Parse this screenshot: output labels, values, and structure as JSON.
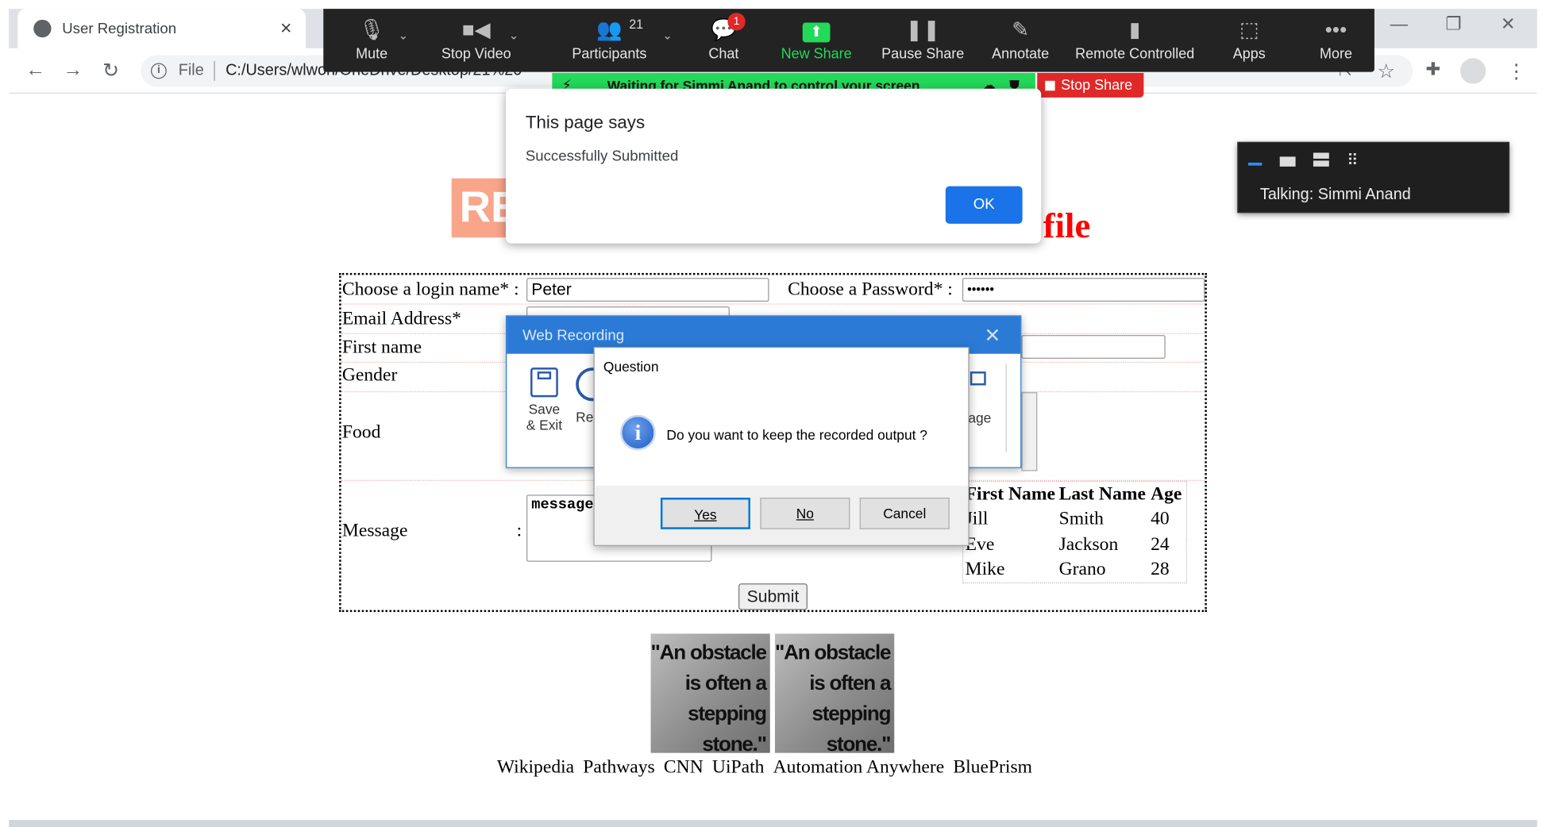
{
  "browser": {
    "tab_title": "User Registration",
    "tab_close": "×",
    "url_scheme": "File",
    "url_path": "C:/Users/wlwon/OneDrive/Desktop/21%20",
    "window_controls": [
      "—",
      "❐",
      "✕"
    ]
  },
  "zoom": {
    "buttons": [
      {
        "label": "Mute",
        "icon": "microphone-icon"
      },
      {
        "label": "Stop Video",
        "icon": "video-camera-icon"
      },
      {
        "label": "Participants",
        "icon": "participants-icon",
        "count": "21"
      },
      {
        "label": "Chat",
        "icon": "chat-icon",
        "badge": "1"
      },
      {
        "label": "New Share",
        "icon": "share-arrow-icon"
      },
      {
        "label": "Pause Share",
        "icon": "pause-icon"
      },
      {
        "label": "Annotate",
        "icon": "pencil-icon"
      },
      {
        "label": "Remote Controlled",
        "icon": "mouse-icon"
      },
      {
        "label": "Apps",
        "icon": "apps-icon"
      },
      {
        "label": "More",
        "icon": "ellipsis-icon"
      }
    ],
    "waiting_text": "Waiting for Simmi Anand to control your screen",
    "stop_share": "Stop Share",
    "talking": "Talking: Simmi Anand",
    "accent": "#23d959",
    "stop_color": "#e02828"
  },
  "page": {
    "logo_text": "REG",
    "title_tail": "file",
    "form": {
      "login_label": "Choose a login name* :",
      "login_value": "Peter",
      "password_label": "Choose a Password* :",
      "password_value": "••••••",
      "email_label": "Email Address*",
      "firstname_label": "First name",
      "gender_label": "Gender",
      "food_label": "Food",
      "message_label": "Message",
      "message_colon": ":",
      "message_value": "message",
      "submit": "Submit"
    },
    "table": {
      "headers": [
        "First Name",
        "Last Name",
        "Age"
      ],
      "rows": [
        [
          "Jill",
          "Smith",
          "40"
        ],
        [
          "Eve",
          "Jackson",
          "24"
        ],
        [
          "Mike",
          "Grano",
          "28"
        ]
      ]
    },
    "quote_lines": [
      "\"An obstacle",
      "is often a",
      "stepping",
      "stone.\""
    ],
    "links": [
      "Wikipedia",
      "Pathways",
      "CNN",
      "UiPath",
      "Automation Anywhere",
      "BluePrism"
    ]
  },
  "alert": {
    "title": "This page says",
    "message": "Successfully Submitted",
    "ok": "OK"
  },
  "web_recording": {
    "title": "Web Recording",
    "save_label_1": "Save",
    "save_label_2": "& Exit",
    "rec_label": "Rec",
    "age_label": "age"
  },
  "question": {
    "title": "Question",
    "message": "Do you want to keep the recorded output ?",
    "yes": "Yes",
    "no": "No",
    "cancel": "Cancel"
  }
}
